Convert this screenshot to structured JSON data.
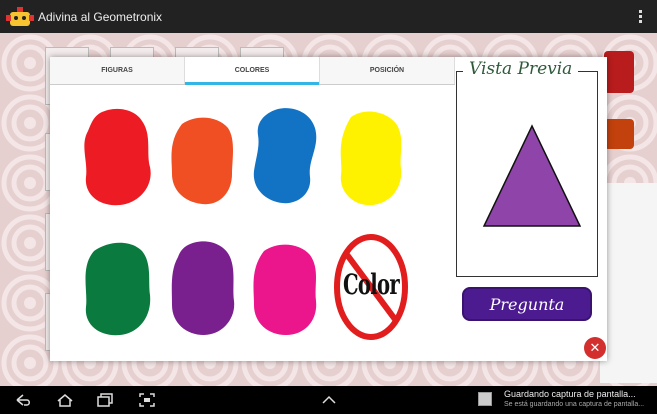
{
  "app": {
    "title": "Adivina al Geometronix"
  },
  "dialog": {
    "tabs": [
      {
        "label": "FIGURAS",
        "active": false
      },
      {
        "label": "COLORES",
        "active": true
      },
      {
        "label": "POSICIÓN",
        "active": false
      }
    ],
    "colors": [
      {
        "name": "red",
        "hex": "#ed1c24"
      },
      {
        "name": "orange",
        "hex": "#f04e23"
      },
      {
        "name": "blue",
        "hex": "#1272c4"
      },
      {
        "name": "yellow",
        "hex": "#fff200"
      },
      {
        "name": "green",
        "hex": "#0b7a3e"
      },
      {
        "name": "purple",
        "hex": "#7a1f8e"
      },
      {
        "name": "pink",
        "hex": "#ec168c"
      }
    ],
    "no_color_label": "Color",
    "preview": {
      "title": "Vista Previa",
      "shape": "triangle",
      "shape_color": "#8e44a8"
    },
    "pregunta_button": "Pregunta"
  },
  "notification": {
    "title": "Guardando captura de pantalla...",
    "subtitle": "Se está guardando una captura de pantalla..."
  }
}
